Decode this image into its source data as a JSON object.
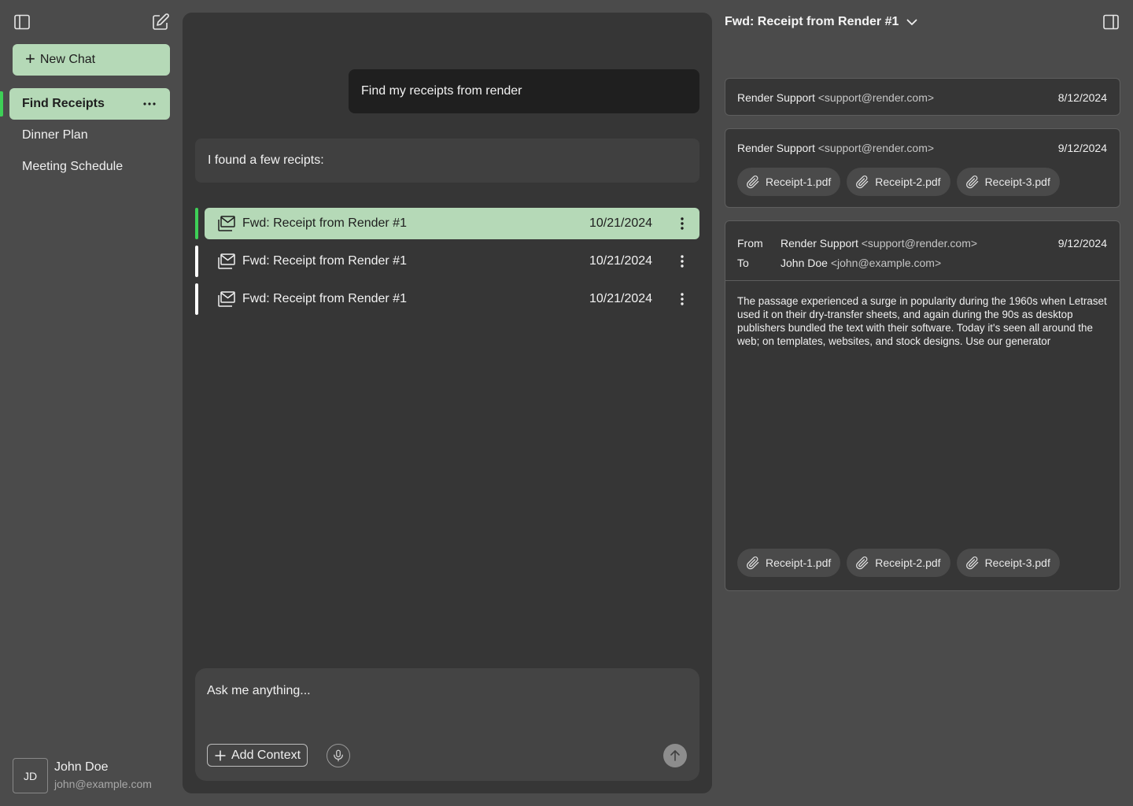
{
  "sidebar": {
    "new_chat_label": "New Chat",
    "chats": [
      {
        "label": "Find Receipts",
        "active": true
      },
      {
        "label": "Dinner Plan",
        "active": false
      },
      {
        "label": "Meeting Schedule",
        "active": false
      }
    ],
    "user": {
      "initials": "JD",
      "name": "John Doe",
      "email": "john@example.com"
    }
  },
  "chat": {
    "user_message": "Find my receipts from render",
    "assistant_message": "I found a few recipts:",
    "emails": [
      {
        "subject": "Fwd: Receipt from Render #1",
        "date": "10/21/2024",
        "active": true
      },
      {
        "subject": "Fwd: Receipt from Render #1",
        "date": "10/21/2024",
        "active": false
      },
      {
        "subject": "Fwd: Receipt from Render #1",
        "date": "10/21/2024",
        "active": false
      }
    ],
    "composer": {
      "placeholder": "Ask me anything...",
      "add_context_label": "Add Context"
    }
  },
  "detail": {
    "title": "Fwd: Receipt from Render #1",
    "cards": [
      {
        "sender_name": "Render Support",
        "sender_addr": "<support@render.com>",
        "date": "8/12/2024"
      },
      {
        "sender_name": "Render Support",
        "sender_addr": "<support@render.com>",
        "date": "9/12/2024",
        "attachments": [
          "Receipt-1.pdf",
          "Receipt-2.pdf",
          "Receipt-3.pdf"
        ]
      }
    ],
    "open_email": {
      "from_label": "From",
      "to_label": "To",
      "from_name": "Render Support",
      "from_addr": "<support@render.com>",
      "to_name": "John Doe",
      "to_addr": "<john@example.com>",
      "date": "9/12/2024",
      "body": "The passage experienced a surge in popularity during the 1960s when Letraset used it on their dry-transfer sheets, and again during the 90s as desktop publishers bundled the text with their software. Today it's seen all around the web; on templates, websites, and stock designs. Use  our generator",
      "attachments": [
        "Receipt-1.pdf",
        "Receipt-2.pdf",
        "Receipt-3.pdf"
      ]
    }
  },
  "colors": {
    "accent_green": "#b5d9b7",
    "active_indicator": "#3ecf57",
    "background": "#4b4b4b",
    "panel": "#363636"
  },
  "icons": [
    "sidebar-toggle-icon",
    "compose-icon",
    "plus-icon",
    "more-horizontal-icon",
    "mail-stack-icon",
    "kebab-icon",
    "paperclip-icon",
    "microphone-icon",
    "arrow-up-icon",
    "chevron-down-icon",
    "right-panel-toggle-icon"
  ]
}
